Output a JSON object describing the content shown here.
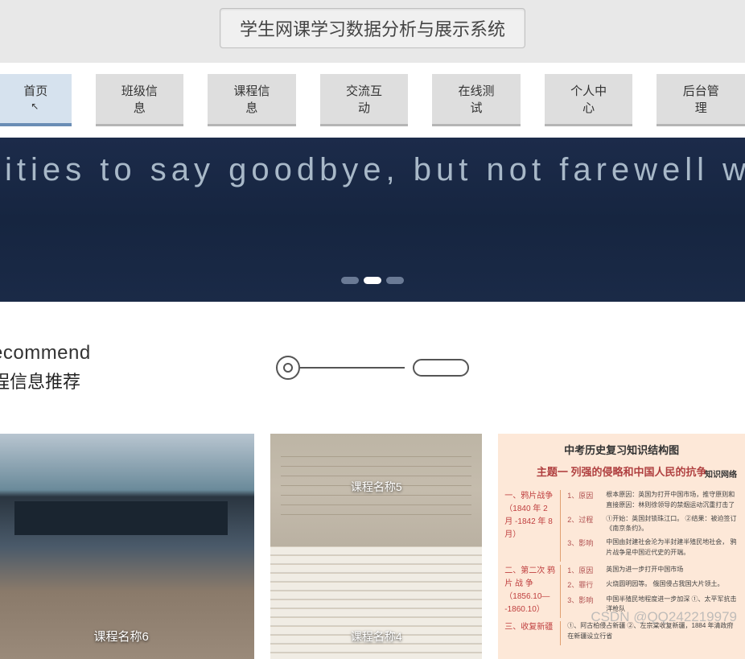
{
  "header": {
    "title": "学生网课学习数据分析与展示系统"
  },
  "nav": {
    "items": [
      {
        "label": "首页",
        "active": true
      },
      {
        "label": "班级信息"
      },
      {
        "label": "课程信息"
      },
      {
        "label": "交流互动"
      },
      {
        "label": "在线测试"
      },
      {
        "label": "个人中心"
      },
      {
        "label": "后台管理"
      }
    ]
  },
  "banner": {
    "text": "sities to say goodbye, but not farewell wit",
    "dots_total": 3,
    "active_dot": 1
  },
  "section": {
    "en": "ecommend",
    "zh": "程信息推荐"
  },
  "cards": [
    {
      "label": "课程名称6"
    },
    {
      "label_top": "课程名称5",
      "label_bottom": "课程名称4"
    },
    {
      "doc_title": "中考历史复习知识结构图",
      "doc_subtitle": "主题一 列强的侵略和中国人民的抗争",
      "doc_note": "知识网络",
      "rows": [
        {
          "left": "一、鸦片战争\n（1840 年 2 月\n-1842 年 8 月）",
          "items": [
            "1、原因",
            "2、过程",
            "3、影响"
          ],
          "details": [
            "根本原因：英国为打开中国市场，推守原则和\n直接原因：林则徐领导的禁烟运动沉重打击了",
            "①开始：英国封锁珠江口。\n②结果：被迫签订《南京条约》。",
            "中国由封建社会沦为半封建半殖民地社会，\n鸦片战争是中国近代史的开端。"
          ]
        },
        {
          "left": "二、第二次\n鸦 片 战 争\n（1856.10—\n-1860.10）",
          "items": [
            "1、原因",
            "2、罪行",
            "3、影响"
          ],
          "details": [
            "英国为进一步打开中国市场",
            "火烧圆明园等。\n俄国侵占我国大片领土。",
            "中国半殖民地程度进一步加深\n①、太平军抗击洋枪队"
          ]
        },
        {
          "left": "三、收复新疆",
          "items": [
            ""
          ],
          "details": [
            "①、阿古柏侵占新疆\n②、左宗棠收复新疆，1884 年清政府在新疆设立行省"
          ]
        }
      ]
    }
  ],
  "watermark": "CSDN @QQ242219979"
}
